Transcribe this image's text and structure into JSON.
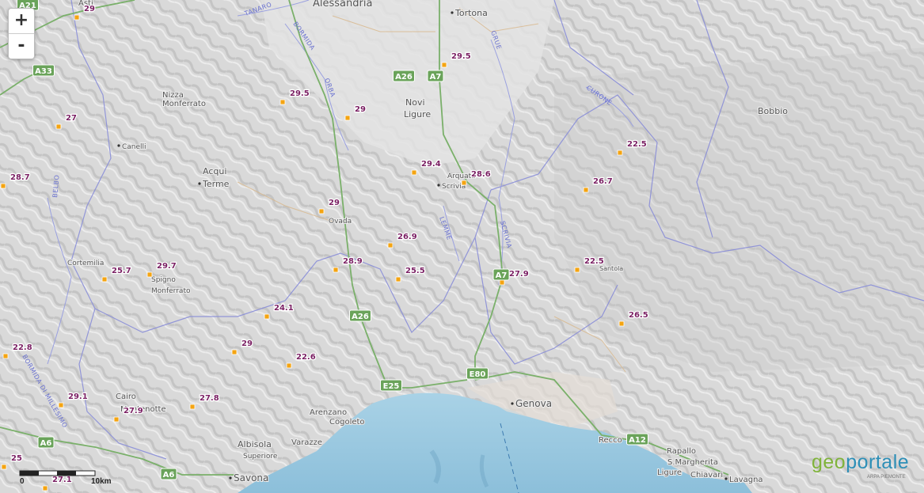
{
  "zoom": {
    "in_label": "+",
    "out_label": "-"
  },
  "logo": {
    "part1": "geo",
    "part2": "portale",
    "sub": "ARPA PIEMONTE"
  },
  "scale": {
    "label0": "0",
    "label1": "10km"
  },
  "colors": {
    "land": "#dadada",
    "sea": "#9cc9e0",
    "marker": "#f4a412",
    "value_text": "#7a1f63",
    "road": "#7ab06a",
    "river": "#8a8ed8"
  },
  "stations": [
    {
      "v": "29"
    },
    {
      "v": "29.5"
    },
    {
      "v": "29.5"
    },
    {
      "v": "29"
    },
    {
      "v": "27"
    },
    {
      "v": "22.5"
    },
    {
      "v": "29.4"
    },
    {
      "v": "28.6"
    },
    {
      "v": "26.7"
    },
    {
      "v": "28.7"
    },
    {
      "v": "29"
    },
    {
      "v": "26.9"
    },
    {
      "v": "28.9"
    },
    {
      "v": "25.5"
    },
    {
      "v": "22.5"
    },
    {
      "v": "27.9"
    },
    {
      "v": "29.7"
    },
    {
      "v": "25.7"
    },
    {
      "v": "24.1"
    },
    {
      "v": "26.5"
    },
    {
      "v": "29"
    },
    {
      "v": "22.8"
    },
    {
      "v": "22.6"
    },
    {
      "v": "29.1"
    },
    {
      "v": "27.8"
    },
    {
      "v": "27.9"
    },
    {
      "v": "25"
    },
    {
      "v": "27.1"
    }
  ],
  "places": [
    {
      "name": "Alessandria"
    },
    {
      "name": "Tortona"
    },
    {
      "name": "Nizza"
    },
    {
      "name": "Monferrato"
    },
    {
      "name": "Novi"
    },
    {
      "name": "Ligure"
    },
    {
      "name": "Canelli"
    },
    {
      "name": "Acqui"
    },
    {
      "name": "Terme"
    },
    {
      "name": "Arquata"
    },
    {
      "name": "Scrivia"
    },
    {
      "name": "Bobbio"
    },
    {
      "name": "Ovada"
    },
    {
      "name": "Cortemilia"
    },
    {
      "name": "Spigno"
    },
    {
      "name": "Monferrato"
    },
    {
      "name": "Santola"
    },
    {
      "name": "Cairo"
    },
    {
      "name": "Montenotte"
    },
    {
      "name": "Arenzano"
    },
    {
      "name": "Cogoleto"
    },
    {
      "name": "Genova"
    },
    {
      "name": "Albisola"
    },
    {
      "name": "Superiore"
    },
    {
      "name": "Varazze"
    },
    {
      "name": "Savona"
    },
    {
      "name": "Recco"
    },
    {
      "name": "Rapallo"
    },
    {
      "name": "S.Margherita"
    },
    {
      "name": "Ligure"
    },
    {
      "name": "Chiavari"
    },
    {
      "name": "Lavagna"
    },
    {
      "name": "Asti"
    }
  ],
  "rivers": [
    {
      "name": "TANARO"
    },
    {
      "name": "BORMIDA"
    },
    {
      "name": "ORBA"
    },
    {
      "name": "CURONE"
    },
    {
      "name": "GRUE"
    },
    {
      "name": "LEMME"
    },
    {
      "name": "SCRIVIA"
    },
    {
      "name": "BELBO"
    },
    {
      "name": "BORMIDA DI MILLESIMO"
    }
  ],
  "roads": [
    {
      "name": "A21"
    },
    {
      "name": "A33"
    },
    {
      "name": "A26"
    },
    {
      "name": "A7"
    },
    {
      "name": "A26"
    },
    {
      "name": "A7"
    },
    {
      "name": "E80"
    },
    {
      "name": "E25"
    },
    {
      "name": "A12"
    },
    {
      "name": "A6"
    },
    {
      "name": "A6"
    }
  ]
}
